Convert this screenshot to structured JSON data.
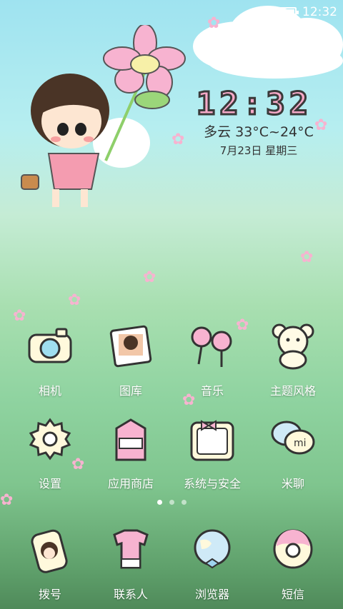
{
  "status_bar": {
    "time": "12:32"
  },
  "widget": {
    "clock": "12:32",
    "weather": "多云 33°C~24°C",
    "date": "7月23日 星期三"
  },
  "apps_row1": [
    {
      "label": "相机",
      "icon": "camera-icon"
    },
    {
      "label": "图库",
      "icon": "gallery-icon"
    },
    {
      "label": "音乐",
      "icon": "music-icon"
    },
    {
      "label": "主题风格",
      "icon": "theme-icon"
    }
  ],
  "apps_row2": [
    {
      "label": "设置",
      "icon": "settings-gear-icon"
    },
    {
      "label": "应用商店",
      "icon": "app-store-icon"
    },
    {
      "label": "系统与安全",
      "icon": "security-icon"
    },
    {
      "label": "米聊",
      "icon": "chat-bubble-icon"
    }
  ],
  "pager": {
    "pages": 3,
    "current": 1
  },
  "dock": [
    {
      "label": "拨号",
      "icon": "phone-icon"
    },
    {
      "label": "联系人",
      "icon": "contacts-icon"
    },
    {
      "label": "浏览器",
      "icon": "browser-globe-icon"
    },
    {
      "label": "短信",
      "icon": "sms-icon"
    }
  ],
  "colors": {
    "accent_pink": "#f6a9c8",
    "sky": "#9fe3f0",
    "grass": "#8fd3a0"
  }
}
